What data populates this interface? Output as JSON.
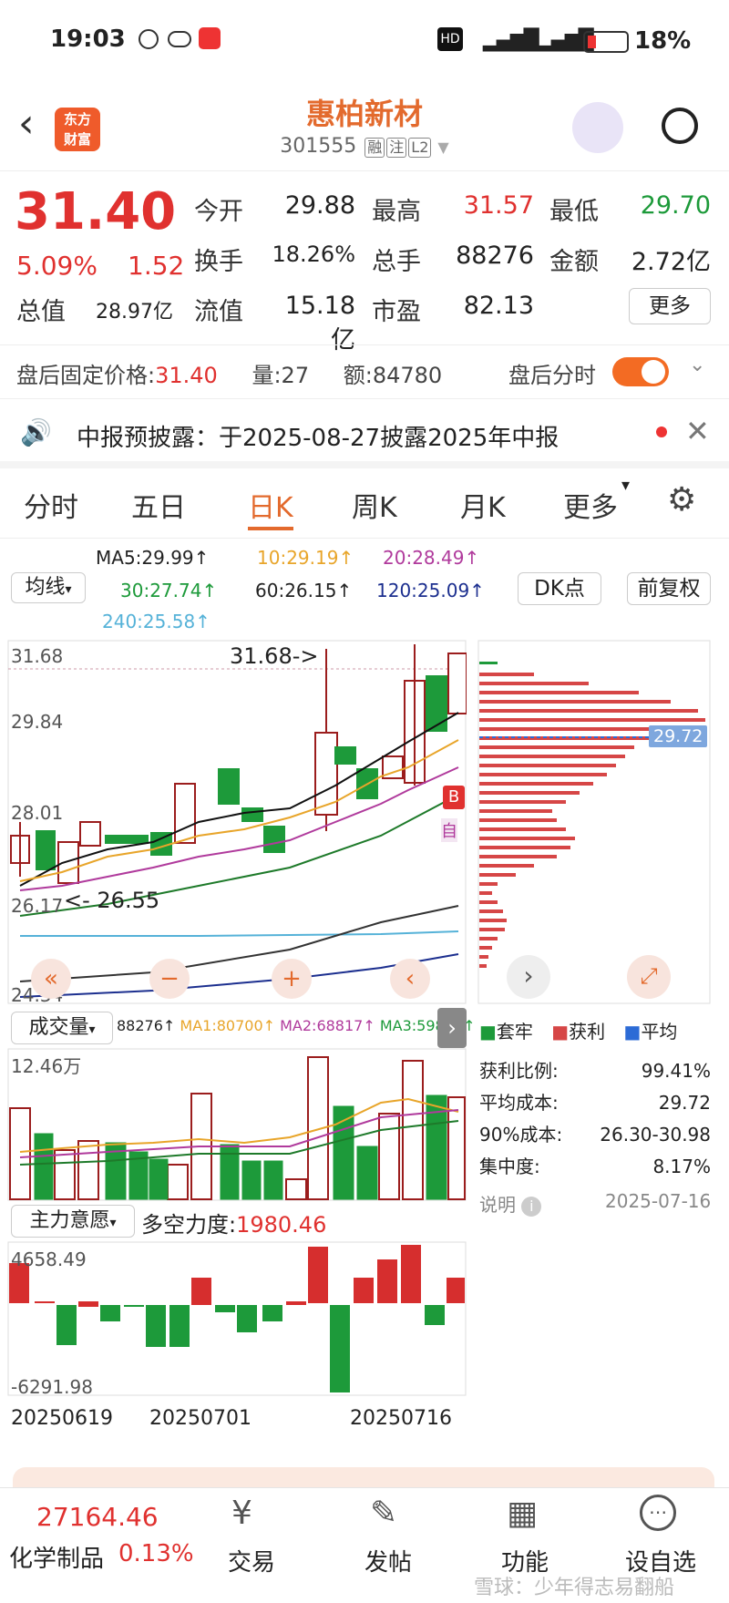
{
  "status": {
    "time": "19:03",
    "battery": "18%"
  },
  "header": {
    "logo_line1": "东方",
    "logo_line2": "财富",
    "name": "惠柏新材",
    "code": "301555",
    "tags": [
      "融",
      "注",
      "L2"
    ]
  },
  "quote": {
    "price": "31.40",
    "pct": "5.09%",
    "change": "1.52",
    "open_label": "今开",
    "open": "29.88",
    "high_label": "最高",
    "high": "31.57",
    "low_label": "最低",
    "low": "29.70",
    "turnover_label": "换手",
    "turnover": "18.26%",
    "vol_label": "总手",
    "vol": "88276",
    "amount_label": "金额",
    "amount": "2.72亿",
    "mcap_label": "总值",
    "mcap": "28.97亿",
    "float_label": "流值",
    "float": "15.18亿",
    "pe_label": "市盈",
    "pe": "82.13",
    "more": "更多"
  },
  "after": {
    "label": "盘后固定价格:",
    "price": "31.40",
    "vol_label": "量:",
    "vol": "27",
    "amt_label": "额:",
    "amt": "84780",
    "toggle_label": "盘后分时"
  },
  "notice": {
    "text": "中报预披露：于2025-08-27披露2025年中报"
  },
  "tabs": [
    "分时",
    "五日",
    "日K",
    "周K",
    "月K",
    "更多"
  ],
  "ma": {
    "selector": "均线",
    "ma5": "MA5:29.99↑",
    "ma10": "10:29.19↑",
    "ma20": "20:28.49↑",
    "ma30": "30:27.74↑",
    "ma60": "60:26.15↑",
    "ma120": "120:25.09↑",
    "ma240": "240:25.58↑",
    "dk": "DK点",
    "adj": "前复权"
  },
  "kline": {
    "y_labels": [
      "31.68",
      "29.84",
      "28.01",
      "26.17",
      "24.34"
    ],
    "high_mark": "31.68->",
    "low_mark": "<- 26.55",
    "cost_tag": "29.72",
    "b_mark": "B",
    "zi_mark": "自"
  },
  "volume": {
    "selector": "成交量",
    "v": "88276↑",
    "ma1": "MA1:80700↑",
    "ma2": "MA2:68817↑",
    "ma3": "MA3:59881↑",
    "max": "12.46万"
  },
  "chips": {
    "legend": [
      "套牢",
      "获利",
      "平均"
    ],
    "rows": [
      {
        "k": "获利比例:",
        "v": "99.41%"
      },
      {
        "k": "平均成本:",
        "v": "29.72"
      },
      {
        "k": "90%成本:",
        "v": "26.30-30.98"
      },
      {
        "k": "集中度:",
        "v": "8.17%"
      }
    ],
    "note": "说明",
    "date": "2025-07-16"
  },
  "force": {
    "selector": "主力意愿",
    "label": "多空力度:",
    "value": "1980.46",
    "max": "4658.49",
    "min": "-6291.98"
  },
  "dates": [
    "20250619",
    "20250701",
    "20250716"
  ],
  "bottom": {
    "index_val": "27164.46",
    "index_name": "化学制品",
    "index_pct": "0.13%",
    "items": [
      "交易",
      "发帖",
      "功能",
      "设自选"
    ],
    "watermark": "雪球：少年得志易翻船"
  },
  "colors": {
    "up": "#e0312f",
    "down": "#1d9a3a",
    "accent": "#e36a2d"
  }
}
